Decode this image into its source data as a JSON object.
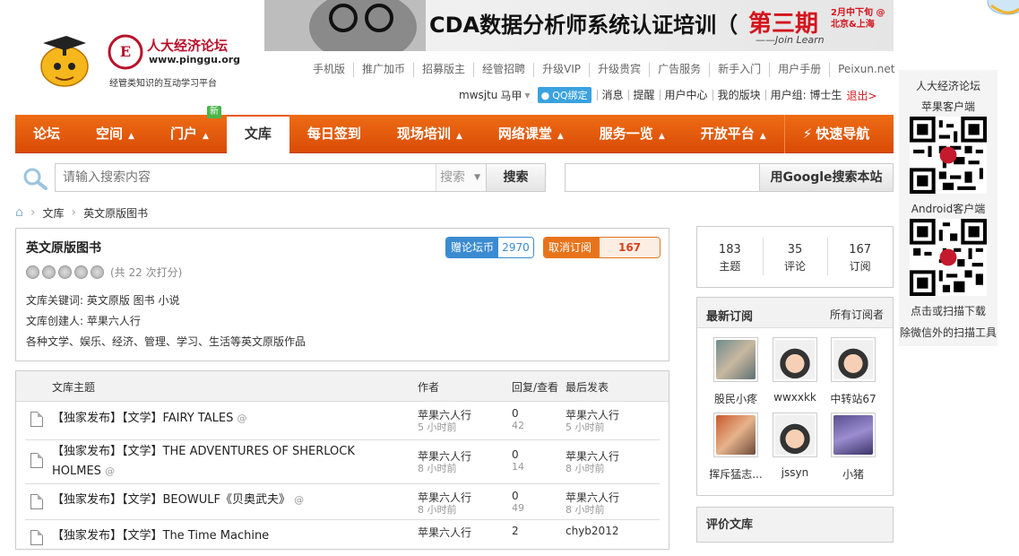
{
  "header": {
    "brand_title": "人大经济论坛",
    "brand_url": "www.pinggu.org",
    "brand_slogan": "经管类知识的互动学习平台",
    "banner_text": "CDA数据分析师系统认证培训（",
    "banner_period": "第三期",
    "banner_side": "2月中下旬 @北京&上海",
    "banner_sig": "——Join Learn",
    "top_links": [
      "手机版",
      "推广加币",
      "招募版主",
      "经管招聘",
      "升级VIP",
      "升级贵宾",
      "广告服务",
      "新手入门",
      "用户手册",
      "Peixun.net"
    ],
    "user": {
      "name": "mwsjtu",
      "level": "马甲",
      "qq_bind": "QQ绑定",
      "links": [
        "消息",
        "提醒",
        "用户中心",
        "我的版块",
        "用户组: 博士生"
      ],
      "logout": "退出>"
    }
  },
  "nav": {
    "items": [
      {
        "label": "论坛",
        "arrow": ""
      },
      {
        "label": "空间",
        "arrow": "▲"
      },
      {
        "label": "门户",
        "arrow": "▲"
      },
      {
        "label": "文库",
        "arrow": ""
      },
      {
        "label": "每日签到",
        "arrow": ""
      },
      {
        "label": "现场培训",
        "arrow": "▲"
      },
      {
        "label": "网络课堂",
        "arrow": "▲"
      },
      {
        "label": "服务一览",
        "arrow": "▲"
      },
      {
        "label": "开放平台",
        "arrow": "▲"
      },
      {
        "label": "快速导航",
        "arrow": ""
      }
    ],
    "new_badge": "新"
  },
  "search": {
    "placeholder": "请输入搜索内容",
    "select_value": "搜索",
    "button": "搜索",
    "google_button": "用Google搜索本站"
  },
  "breadcrumb": [
    "文库",
    "英文原版图书"
  ],
  "library": {
    "title": "英文原版图书",
    "rating_text": "(共 22 次打分)",
    "keywords": "文库关键词: 英文原版  图书  小说",
    "creator": "文库创建人: 苹果六人行",
    "description": "各种文学、娱乐、经济、管理、学习、生活等英文原版作品",
    "gift_label": "赠论坛币",
    "gift_count": "2970",
    "unsub_label": "取消订阅",
    "unsub_count": "167"
  },
  "list": {
    "headers": {
      "topic": "文库主题",
      "author": "作者",
      "replies": "回复/查看",
      "last": "最后发表"
    },
    "rows": [
      {
        "title": "【独家发布】【文学】FAIRY TALES",
        "author": "苹果六人行",
        "author_time": "5 小时前",
        "replies": "0",
        "views": "42",
        "last_user": "苹果六人行",
        "last_time": "5 小时前"
      },
      {
        "title": "【独家发布】【文学】THE ADVENTURES OF SHERLOCK HOLMES",
        "author": "苹果六人行",
        "author_time": "8 小时前",
        "replies": "0",
        "views": "14",
        "last_user": "苹果六人行",
        "last_time": "8 小时前"
      },
      {
        "title": "【独家发布】【文学】BEOWULF《贝奥武夫》",
        "author": "苹果六人行",
        "author_time": "8 小时前",
        "replies": "0",
        "views": "49",
        "last_user": "苹果六人行",
        "last_time": "8 小时前"
      },
      {
        "title": "【独家发布】【文学】The Time Machine",
        "author": "苹果六人行",
        "author_time": "",
        "replies": "2",
        "views": "",
        "last_user": "chyb2012",
        "last_time": ""
      }
    ]
  },
  "stats": [
    {
      "value": "183",
      "label": "主题"
    },
    {
      "value": "35",
      "label": "评论"
    },
    {
      "value": "167",
      "label": "订阅"
    }
  ],
  "subscribers": {
    "title": "最新订阅",
    "all_link": "所有订阅者",
    "users": [
      "股民小疼",
      "wwxxkk",
      "中转站67",
      "挥斥猛志...",
      "jssyn",
      "小猪"
    ]
  },
  "rate_box": {
    "title": "评价文库"
  },
  "qr": {
    "site": "人大经济论坛",
    "apple": "苹果客户端",
    "android": "Android客户端",
    "tip1": "点击或扫描下载",
    "tip2": "除微信外的扫描工具"
  }
}
